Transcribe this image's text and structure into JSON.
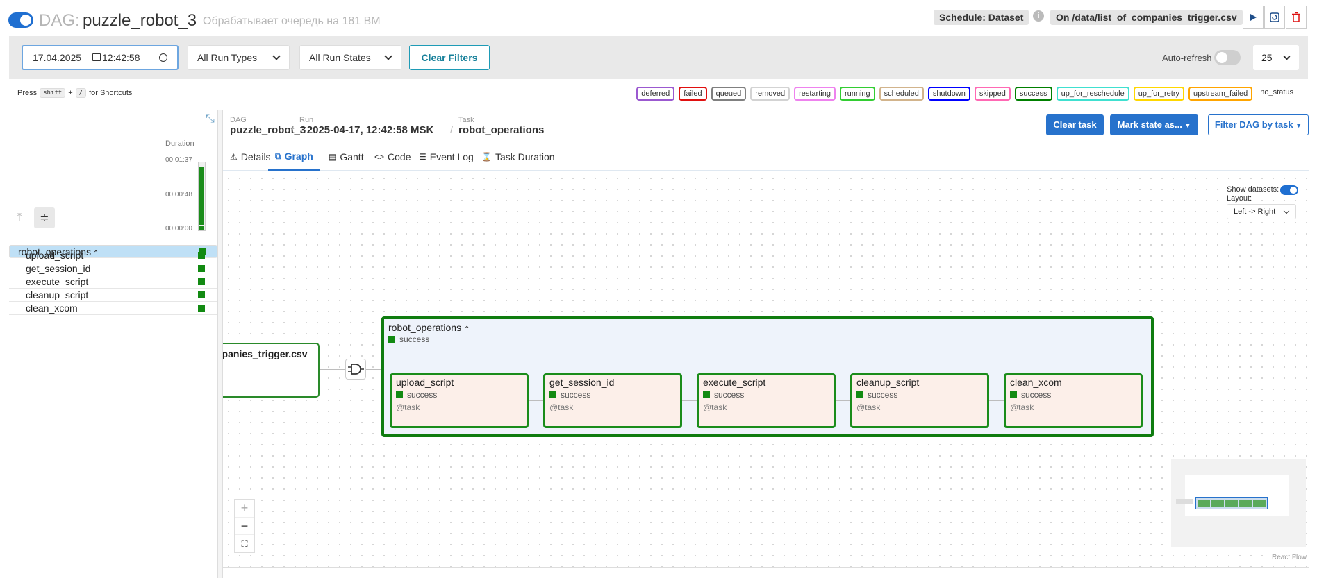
{
  "header": {
    "dag_prefix": "DAG:",
    "dag_name": "puzzle_robot_3",
    "description": "Обрабатывает очередь на 181 ВМ",
    "schedule": "Schedule: Dataset",
    "trigger": "On /data/list_of_companies_trigger.csv",
    "info_icon": "i"
  },
  "filters": {
    "date": "17.04.2025",
    "time": "12:42:58",
    "run_types": "All Run Types",
    "run_states": "All Run States",
    "clear_filters": "Clear Filters",
    "auto_refresh": "Auto-refresh",
    "page_size": "25"
  },
  "shortcuts": {
    "press": "Press",
    "key1": "shift",
    "plus": "+",
    "key2": "/",
    "suffix": "for Shortcuts"
  },
  "legend": [
    {
      "label": "deferred",
      "color": "#9b59d0"
    },
    {
      "label": "failed",
      "color": "#e01010"
    },
    {
      "label": "queued",
      "color": "#808080"
    },
    {
      "label": "removed",
      "color": "#d3d3d3"
    },
    {
      "label": "restarting",
      "color": "#ee82ee"
    },
    {
      "label": "running",
      "color": "#32cd32"
    },
    {
      "label": "scheduled",
      "color": "#d2b48c"
    },
    {
      "label": "shutdown",
      "color": "#0000ff"
    },
    {
      "label": "skipped",
      "color": "#ff69b4"
    },
    {
      "label": "success",
      "color": "#008000"
    },
    {
      "label": "up_for_reschedule",
      "color": "#40e0d0"
    },
    {
      "label": "up_for_retry",
      "color": "#ffd700"
    },
    {
      "label": "upstream_failed",
      "color": "#ffa500"
    },
    {
      "label": "no_status",
      "color": "none"
    }
  ],
  "left_panel": {
    "duration_label": "Duration",
    "dur_max": "00:01:37",
    "dur_mid": "00:00:48",
    "dur_min": "00:00:00",
    "duration_fill": 0.93,
    "tree": [
      {
        "name": "robot_operations",
        "group": true
      },
      {
        "name": "upload_script"
      },
      {
        "name": "get_session_id"
      },
      {
        "name": "execute_script"
      },
      {
        "name": "cleanup_script"
      },
      {
        "name": "clean_xcom"
      }
    ]
  },
  "breadcrumb": {
    "dag_label": "DAG",
    "dag_value": "puzzle_robot_3",
    "run_label": "Run",
    "run_value": "2025-04-17, 12:42:58 MSK",
    "task_label": "Task",
    "task_value": "robot_operations"
  },
  "actions": {
    "clear_task": "Clear task",
    "mark_state": "Mark state as...",
    "filter_dag": "Filter DAG by task"
  },
  "tabs": [
    {
      "label": "Details",
      "icon": "⚠"
    },
    {
      "label": "Graph",
      "icon": "⧉"
    },
    {
      "label": "Gantt",
      "icon": "▤"
    },
    {
      "label": "Code",
      "icon": "<>"
    },
    {
      "label": "Event Log",
      "icon": "☰"
    },
    {
      "label": "Task Duration",
      "icon": "⌛"
    }
  ],
  "graph": {
    "show_datasets": "Show datasets:",
    "layout_label": "Layout:",
    "layout_value": "Left -> Right",
    "dataset_node": "npanies_trigger.csv",
    "group": {
      "name": "robot_operations",
      "status": "success"
    },
    "tasks": [
      {
        "name": "upload_script",
        "status": "success",
        "operator": "@task"
      },
      {
        "name": "get_session_id",
        "status": "success",
        "operator": "@task"
      },
      {
        "name": "execute_script",
        "status": "success",
        "operator": "@task"
      },
      {
        "name": "cleanup_script",
        "status": "success",
        "operator": "@task"
      },
      {
        "name": "clean_xcom",
        "status": "success",
        "operator": "@task"
      }
    ],
    "zoom_in": "+",
    "zoom_out": "−",
    "fit": "⛶",
    "react_flow": "React Flow"
  },
  "colors": {
    "accent": "#2772cc",
    "success": "#008000"
  }
}
